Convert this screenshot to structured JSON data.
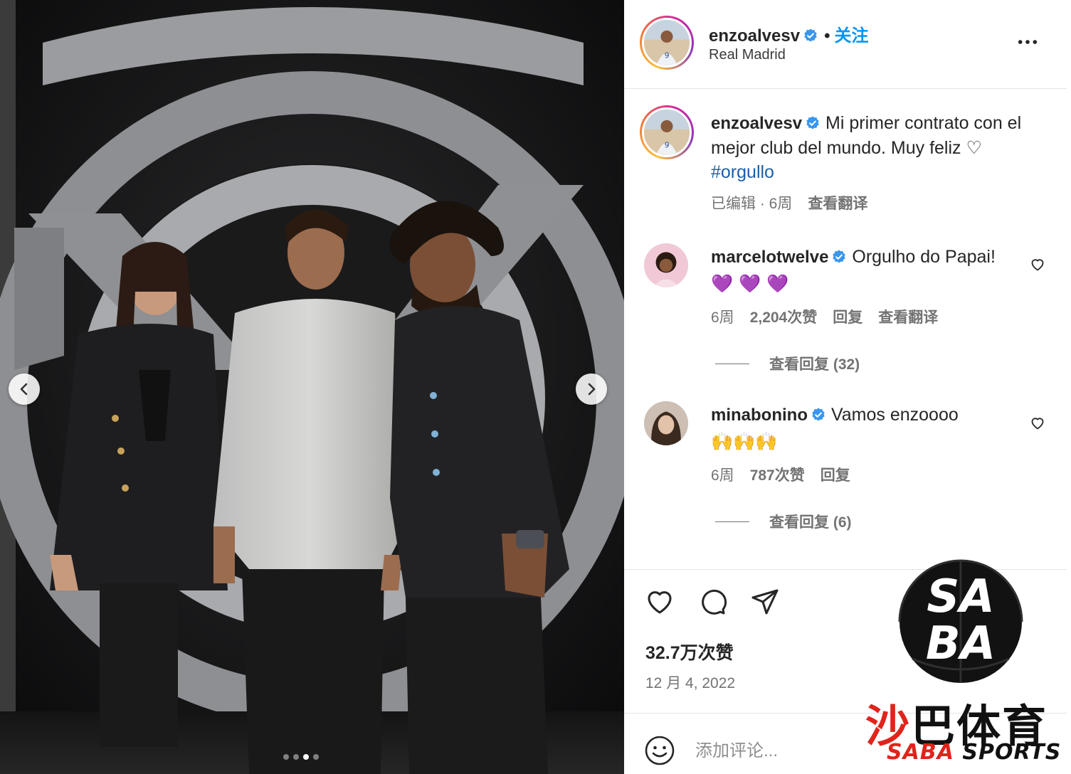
{
  "carousel": {
    "dots": 4,
    "active_dot": 3,
    "prev_icon": "chevron-left-icon",
    "next_icon": "chevron-right-icon"
  },
  "header": {
    "username": "enzoalvesv",
    "separator": "•",
    "follow_label": "关注",
    "location": "Real Madrid",
    "more_icon": "more-horizontal-icon"
  },
  "caption": {
    "username": "enzoalvesv",
    "text": "Mi primer contrato con el mejor club del mundo. Muy feliz",
    "heart": "♡",
    "hashtag": "#orgullo",
    "edited": "已编辑 · 6周",
    "translate": "查看翻译"
  },
  "comments": [
    {
      "username": "marcelotwelve",
      "text": "Orgulho do Papai!",
      "emoji": "💜 💜 💜",
      "time": "6周",
      "likes": "2,204次赞",
      "reply": "回复",
      "translate": "查看翻译",
      "view_replies": "查看回复 (32)"
    },
    {
      "username": "minabonino",
      "text": "Vamos enzoooo",
      "emoji": "🙌🙌🙌",
      "time": "6周",
      "likes": "787次赞",
      "reply": "回复",
      "view_replies": "查看回复 (6)"
    }
  ],
  "actions": {
    "like_icon": "heart-icon",
    "comment_icon": "comment-icon",
    "share_icon": "share-icon",
    "likes_count": "32.7万次赞",
    "date": "12 月 4, 2022"
  },
  "comment_box": {
    "placeholder": "添加评论...",
    "emoji_icon": "smiley-icon"
  },
  "watermark": {
    "cn_red": "沙",
    "cn_black": "巴体育",
    "en_red": "SABA",
    "en_black": "SPORTS",
    "badge_top": "SA",
    "badge_bottom": "BA"
  },
  "colors": {
    "link": "#0095f6",
    "hashtag": "#1c5fa8",
    "verified": "#3897f0",
    "muted": "#737373",
    "watermark_red": "#e0241b"
  }
}
